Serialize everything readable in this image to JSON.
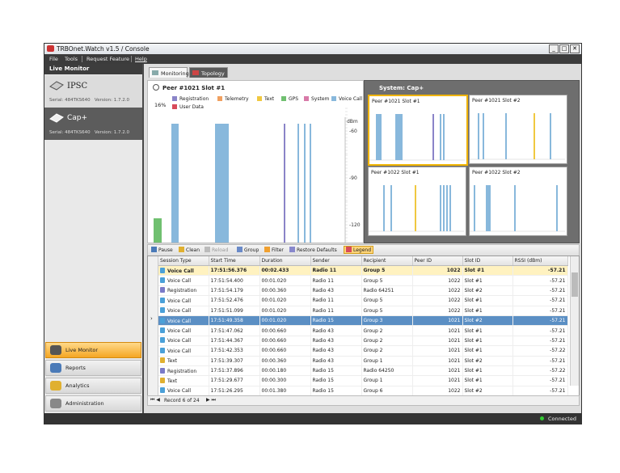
{
  "window": {
    "title": "TRBOnet.Watch v1.5 / Console"
  },
  "menu": {
    "items": [
      "File",
      "Tools",
      "Request Feature",
      "Help"
    ]
  },
  "sidebar": {
    "header": "Live Monitor",
    "systems": [
      {
        "name": "IPSC",
        "serial": "Serial: 484TKS640",
        "version": "Version: 1.7.2.0"
      },
      {
        "name": "Cap+",
        "serial": "Serial: 484TKS640",
        "version": "Version: 1.7.2.0"
      }
    ],
    "nav": [
      {
        "label": "Live Monitor",
        "icon": "live-monitor-icon",
        "active": true
      },
      {
        "label": "Reports",
        "icon": "reports-icon"
      },
      {
        "label": "Analytics",
        "icon": "analytics-icon"
      },
      {
        "label": "Administration",
        "icon": "administration-icon"
      }
    ]
  },
  "tabs": {
    "monitoring": "Monitoring",
    "topology": "Topology"
  },
  "peer_panel": {
    "title": "Peer #1021 Slot #1",
    "percent": "16%",
    "dbm_label": "dBm",
    "legend": [
      {
        "label": "Registration",
        "color": "#8a84c8"
      },
      {
        "label": "Telemetry",
        "color": "#f0a060"
      },
      {
        "label": "Text",
        "color": "#f0c840"
      },
      {
        "label": "GPS",
        "color": "#70c070"
      },
      {
        "label": "System",
        "color": "#d87aa8"
      },
      {
        "label": "Voice Call",
        "color": "#88b8dc"
      },
      {
        "label": "User Data",
        "color": "#d84a5a"
      }
    ]
  },
  "chart_data": {
    "type": "bar",
    "y_ticks": [
      "-60",
      "-90",
      "-120"
    ],
    "ylabel": "dBm",
    "series_colors": {
      "voice": "#88b8dc",
      "registration": "#8a84c8",
      "gps": "#70c070",
      "text": "#f0c840"
    }
  },
  "system_panel": {
    "title": "System: Cap+",
    "peers": [
      {
        "title": "Peer #1021 Slot #1",
        "selected": true
      },
      {
        "title": "Peer #1021 Slot #2"
      },
      {
        "title": "Peer #1022 Slot #1"
      },
      {
        "title": "Peer #1022 Slot #2"
      }
    ]
  },
  "toolbar": {
    "pause": "Pause",
    "clean": "Clean",
    "reload": "Reload",
    "group": "Group",
    "filter": "Filter",
    "restore": "Restore Defaults",
    "legend": "Legend"
  },
  "grid": {
    "columns": [
      "Session Type",
      "Start Time",
      "Duration",
      "Sender",
      "Recipient",
      "Peer ID",
      "Slot ID",
      "RSSI (dBm)"
    ],
    "rows": [
      {
        "type": "Voice Call",
        "start": "17:51:56.376",
        "duration": "00:02.433",
        "sender": "Radio 11",
        "recipient": "Group 5",
        "peer": "1022",
        "slot": "Slot #1",
        "rssi": "-57.21",
        "style": "bold"
      },
      {
        "type": "Voice Call",
        "start": "17:51:54.400",
        "duration": "00:01.020",
        "sender": "Radio 11",
        "recipient": "Group 5",
        "peer": "1022",
        "slot": "Slot #1",
        "rssi": "-57.21"
      },
      {
        "type": "Registration",
        "start": "17:51:54.179",
        "duration": "00:00.360",
        "sender": "Radio 43",
        "recipient": "Radio 64251",
        "peer": "1022",
        "slot": "Slot #2",
        "rssi": "-57.21"
      },
      {
        "type": "Voice Call",
        "start": "17:51:52.476",
        "duration": "00:01.020",
        "sender": "Radio 11",
        "recipient": "Group 5",
        "peer": "1022",
        "slot": "Slot #1",
        "rssi": "-57.21"
      },
      {
        "type": "Voice Call",
        "start": "17:51:51.099",
        "duration": "00:01.020",
        "sender": "Radio 11",
        "recipient": "Group 5",
        "peer": "1022",
        "slot": "Slot #1",
        "rssi": "-57.21"
      },
      {
        "type": "Voice Call",
        "start": "17:51:49.358",
        "duration": "00:01.020",
        "sender": "Radio 15",
        "recipient": "Group 3",
        "peer": "1021",
        "slot": "Slot #2",
        "rssi": "-57.21",
        "style": "sel"
      },
      {
        "type": "Voice Call",
        "start": "17:51:47.062",
        "duration": "00:00.660",
        "sender": "Radio 43",
        "recipient": "Group 2",
        "peer": "1021",
        "slot": "Slot #1",
        "rssi": "-57.21"
      },
      {
        "type": "Voice Call",
        "start": "17:51:44.367",
        "duration": "00:00.660",
        "sender": "Radio 43",
        "recipient": "Group 2",
        "peer": "1021",
        "slot": "Slot #1",
        "rssi": "-57.21"
      },
      {
        "type": "Voice Call",
        "start": "17:51:42.353",
        "duration": "00:00.660",
        "sender": "Radio 43",
        "recipient": "Group 2",
        "peer": "1021",
        "slot": "Slot #1",
        "rssi": "-57.22"
      },
      {
        "type": "Text",
        "start": "17:51:39.307",
        "duration": "00:00.360",
        "sender": "Radio 43",
        "recipient": "Group 1",
        "peer": "1021",
        "slot": "Slot #2",
        "rssi": "-57.21"
      },
      {
        "type": "Registration",
        "start": "17:51:37.896",
        "duration": "00:00.180",
        "sender": "Radio 15",
        "recipient": "Radio 64250",
        "peer": "1021",
        "slot": "Slot #1",
        "rssi": "-57.22"
      },
      {
        "type": "Text",
        "start": "17:51:29.677",
        "duration": "00:00.300",
        "sender": "Radio 15",
        "recipient": "Group 1",
        "peer": "1021",
        "slot": "Slot #1",
        "rssi": "-57.21"
      },
      {
        "type": "Voice Call",
        "start": "17:51:26.295",
        "duration": "00:01.380",
        "sender": "Radio 15",
        "recipient": "Group 6",
        "peer": "1022",
        "slot": "Slot #2",
        "rssi": "-57.21"
      }
    ]
  },
  "navigator": {
    "record": "Record 6 of 24"
  },
  "status": {
    "text": "Connected"
  }
}
